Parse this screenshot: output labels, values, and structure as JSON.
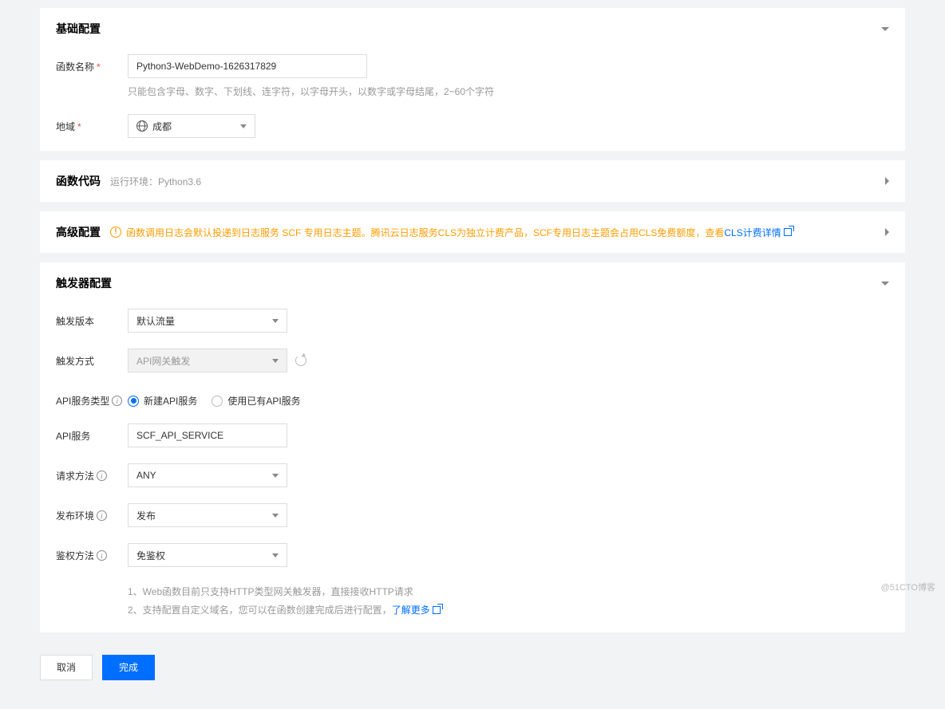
{
  "basic": {
    "title": "基础配置",
    "labels": {
      "name": "函数名称",
      "region": "地域"
    },
    "name_value": "Python3-WebDemo-1626317829",
    "name_help": "只能包含字母、数字、下划线、连字符，以字母开头，以数字或字母结尾，2~60个字符",
    "region_value": "成都"
  },
  "code": {
    "title": "函数代码",
    "runtime_label": "运行环境：",
    "runtime_value": "Python3.6"
  },
  "advanced": {
    "title": "高级配置",
    "warn_text": "函数调用日志会默认投递到日志服务 SCF 专用日志主题。腾讯云日志服务CLS为独立计费产品，SCF专用日志主题会占用CLS免费额度，查看",
    "link_label": "CLS计费详情"
  },
  "trigger": {
    "title": "触发器配置",
    "labels": {
      "version": "触发版本",
      "method": "触发方式",
      "api_type": "API服务类型",
      "api_service": "API服务",
      "request_method": "请求方法",
      "publish_env": "发布环境",
      "auth": "鉴权方法"
    },
    "values": {
      "version": "默认流量",
      "method": "API网关触发",
      "api_service": "SCF_API_SERVICE",
      "request_method": "ANY",
      "publish_env": "发布",
      "auth": "免鉴权"
    },
    "api_type_options": {
      "create": "新建API服务",
      "existing": "使用已有API服务"
    },
    "notes": {
      "line1": "1、Web函数目前只支持HTTP类型网关触发器，直接接收HTTP请求",
      "line2_prefix": "2、支持配置自定义域名，您可以在函数创建完成后进行配置，",
      "line2_link": "了解更多"
    }
  },
  "footer": {
    "cancel": "取消",
    "finish": "完成"
  },
  "watermark": "@51CTO博客"
}
